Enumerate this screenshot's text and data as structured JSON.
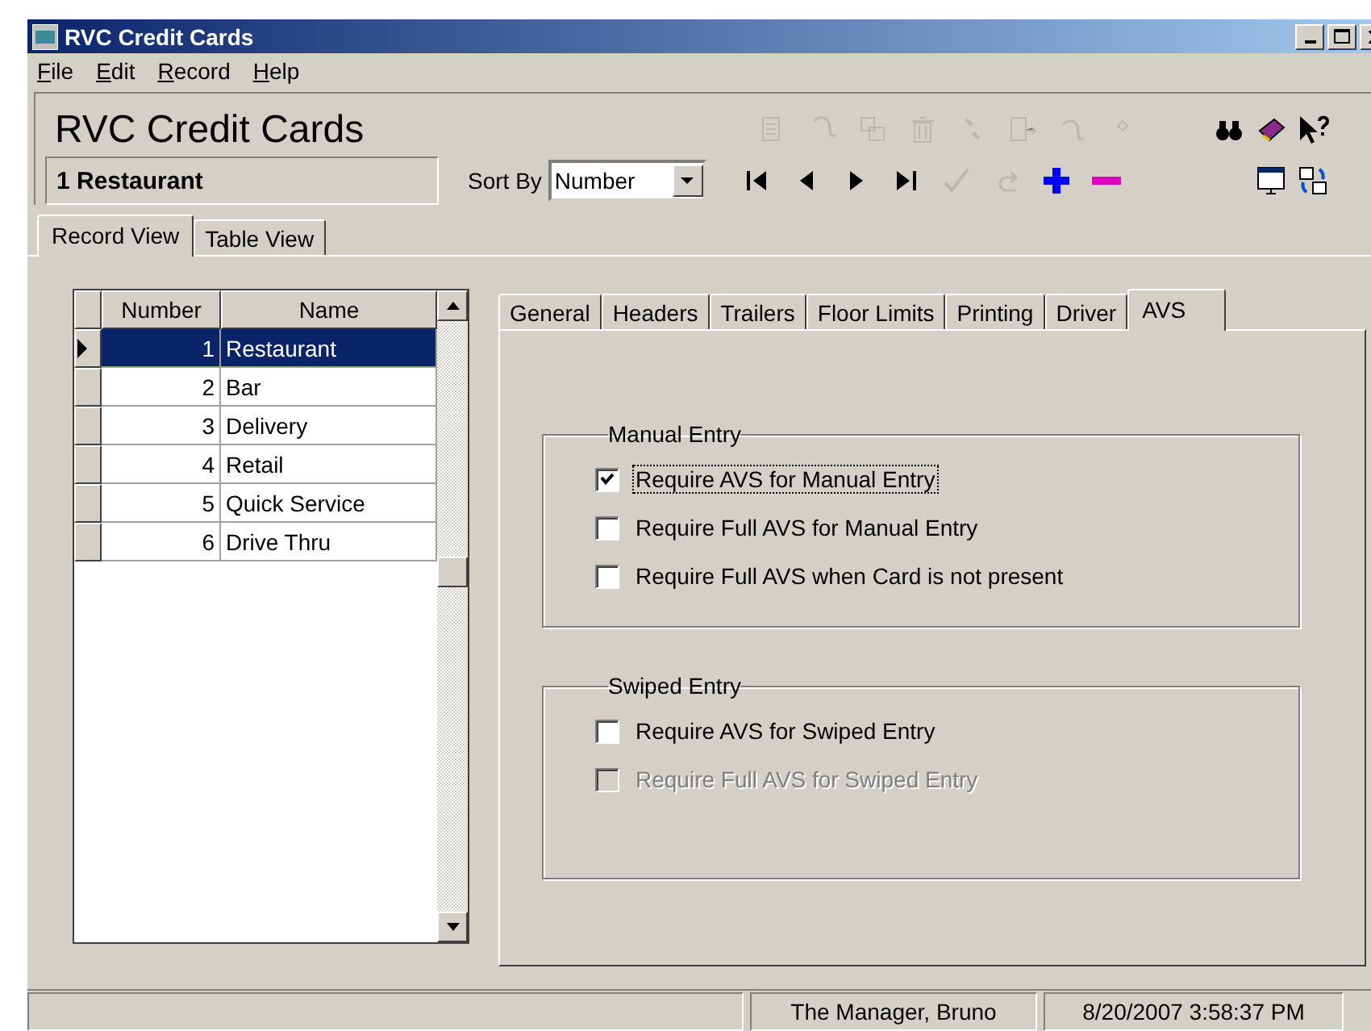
{
  "window": {
    "title": "RVC Credit Cards"
  },
  "menu": [
    "File",
    "Edit",
    "Record",
    "Help"
  ],
  "header": {
    "title": "RVC Credit Cards",
    "record": "1 Restaurant",
    "sort_label": "Sort By",
    "sort_value": "Number"
  },
  "toolbar_top": [
    {
      "kind": "copy",
      "disabled": true
    },
    {
      "kind": "paste",
      "disabled": true
    },
    {
      "kind": "replace",
      "disabled": true
    },
    {
      "kind": "delete",
      "disabled": true
    },
    {
      "kind": "swap",
      "disabled": true
    },
    {
      "kind": "export",
      "disabled": true
    },
    {
      "kind": "import",
      "disabled": true
    },
    {
      "kind": "diamond",
      "disabled": true
    }
  ],
  "toolbar_help": [
    {
      "kind": "find",
      "disabled": false
    },
    {
      "kind": "book",
      "disabled": false
    },
    {
      "kind": "whatsthis",
      "disabled": false
    }
  ],
  "navigation": [
    {
      "kind": "first",
      "disabled": false
    },
    {
      "kind": "prev",
      "disabled": false
    },
    {
      "kind": "next",
      "disabled": false
    },
    {
      "kind": "last",
      "disabled": false
    },
    {
      "kind": "confirm",
      "disabled": true
    },
    {
      "kind": "undo",
      "disabled": true
    },
    {
      "kind": "add",
      "disabled": false
    },
    {
      "kind": "remove",
      "disabled": false
    }
  ],
  "toolbar_view": [
    {
      "kind": "window",
      "disabled": false
    },
    {
      "kind": "refresh",
      "disabled": false
    }
  ],
  "view_tabs": [
    {
      "label": "Record View",
      "selected": true
    },
    {
      "label": "Table View",
      "selected": false
    }
  ],
  "grid": {
    "columns": [
      "Number",
      "Name"
    ],
    "rows": [
      {
        "number": "1",
        "name": "Restaurant",
        "selected": true
      },
      {
        "number": "2",
        "name": "Bar",
        "selected": false
      },
      {
        "number": "3",
        "name": "Delivery",
        "selected": false
      },
      {
        "number": "4",
        "name": "Retail",
        "selected": false
      },
      {
        "number": "5",
        "name": "Quick Service",
        "selected": false
      },
      {
        "number": "6",
        "name": "Drive Thru",
        "selected": false
      }
    ]
  },
  "detail_tabs": [
    {
      "label": "General",
      "selected": false
    },
    {
      "label": "Headers",
      "selected": false
    },
    {
      "label": "Trailers",
      "selected": false
    },
    {
      "label": "Floor Limits",
      "selected": false
    },
    {
      "label": "Printing",
      "selected": false
    },
    {
      "label": "Driver",
      "selected": false
    },
    {
      "label": "AVS",
      "selected": true
    }
  ],
  "groups": [
    {
      "title": "Manual Entry",
      "options": [
        {
          "label": "Require AVS for Manual Entry",
          "checked": true,
          "disabled": false,
          "focused": true
        },
        {
          "label": "Require Full AVS for Manual Entry",
          "checked": false,
          "disabled": false,
          "focused": false
        },
        {
          "label": "Require Full AVS when Card is not present",
          "checked": false,
          "disabled": false,
          "focused": false
        }
      ]
    },
    {
      "title": "Swiped Entry",
      "options": [
        {
          "label": "Require AVS for Swiped Entry",
          "checked": false,
          "disabled": false,
          "focused": false
        },
        {
          "label": "Require Full AVS for Swiped Entry",
          "checked": false,
          "disabled": true,
          "focused": false
        }
      ]
    }
  ],
  "status_bar": [
    "The Manager, Bruno",
    "8/20/2007 3:58:37 PM"
  ]
}
